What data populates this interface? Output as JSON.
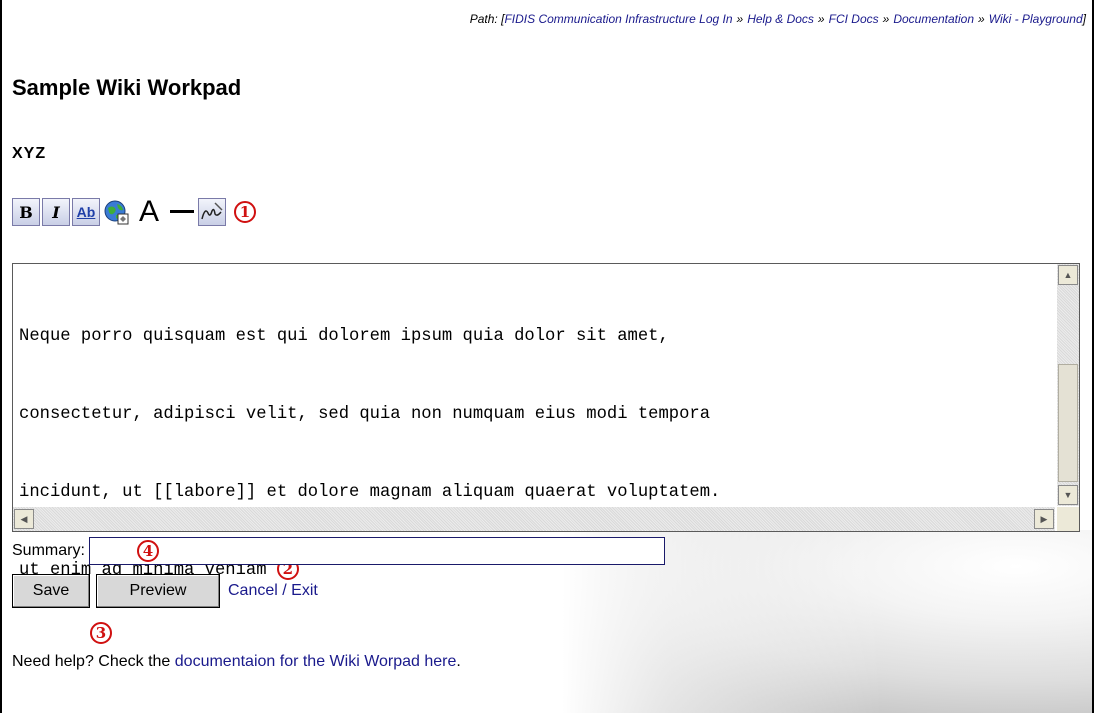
{
  "breadcrumb": {
    "prefix": "Path: [",
    "items": [
      "FIDIS Communication Infrastructure Log In",
      "Help & Docs",
      "FCI Docs",
      "Documentation",
      "Wiki - Playground"
    ],
    "separator": "»",
    "suffix": "]"
  },
  "page_title": "Sample Wiki Workpad",
  "sub_heading": "XYZ",
  "toolbar": {
    "bold": "B",
    "italic": "I",
    "underline": "Ab",
    "big_text": "A",
    "callout": "1"
  },
  "editor": {
    "lines": [
      "Neque porro quisquam est qui dolorem ipsum quia dolor sit amet,",
      "consectetur, adipisci velit, sed quia non numquam eius modi tempora",
      "incidunt, ut [[labore]] et dolore magnam aliquam quaerat voluptatem.",
      "ut enim ad minima veniam "
    ],
    "callout": "2"
  },
  "summary": {
    "label": "Summary:",
    "value": "",
    "callout": "4"
  },
  "actions": {
    "save_label": "Save",
    "preview_label": "Preview",
    "cancel_label": "Cancel / Exit",
    "callout": "3"
  },
  "help": {
    "prefix": "Need help? Check the ",
    "link": "documentaion for the Wiki Worpad here",
    "suffix": "."
  }
}
